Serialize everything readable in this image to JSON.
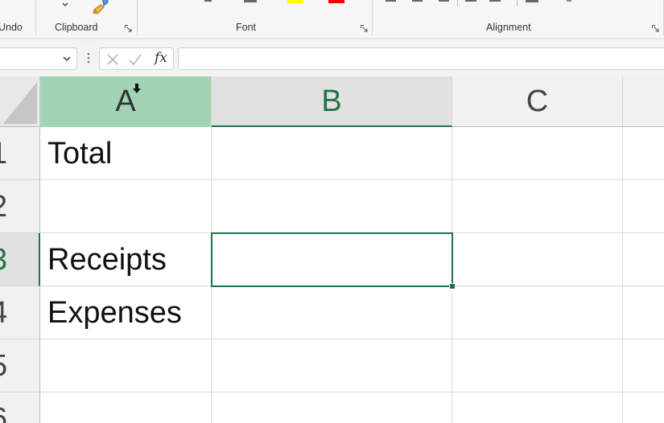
{
  "ribbon": {
    "groups": [
      {
        "name": "undo",
        "label": "Undo"
      },
      {
        "name": "clipboard",
        "label": "Clipboard"
      },
      {
        "name": "font",
        "label": "Font"
      },
      {
        "name": "alignment",
        "label": "Alignment"
      }
    ],
    "highlight_color": "#ffff00",
    "font_color": "#ff0000"
  },
  "formula_bar": {
    "name_box_value": "",
    "fx_label": "fx",
    "formula_value": ""
  },
  "sheet": {
    "columns": [
      "A",
      "B",
      "C"
    ],
    "rows": [
      "1",
      "2",
      "3",
      "4",
      "5",
      "6"
    ],
    "cells": {
      "A1": "Total",
      "A2": "",
      "A3": "Receipts",
      "A4": "Expenses",
      "A5": "",
      "A6": ""
    },
    "active_cell": "B3",
    "selected_column": "A",
    "accent_color": "#217346",
    "selected_column_color": "#a1d4b4"
  }
}
